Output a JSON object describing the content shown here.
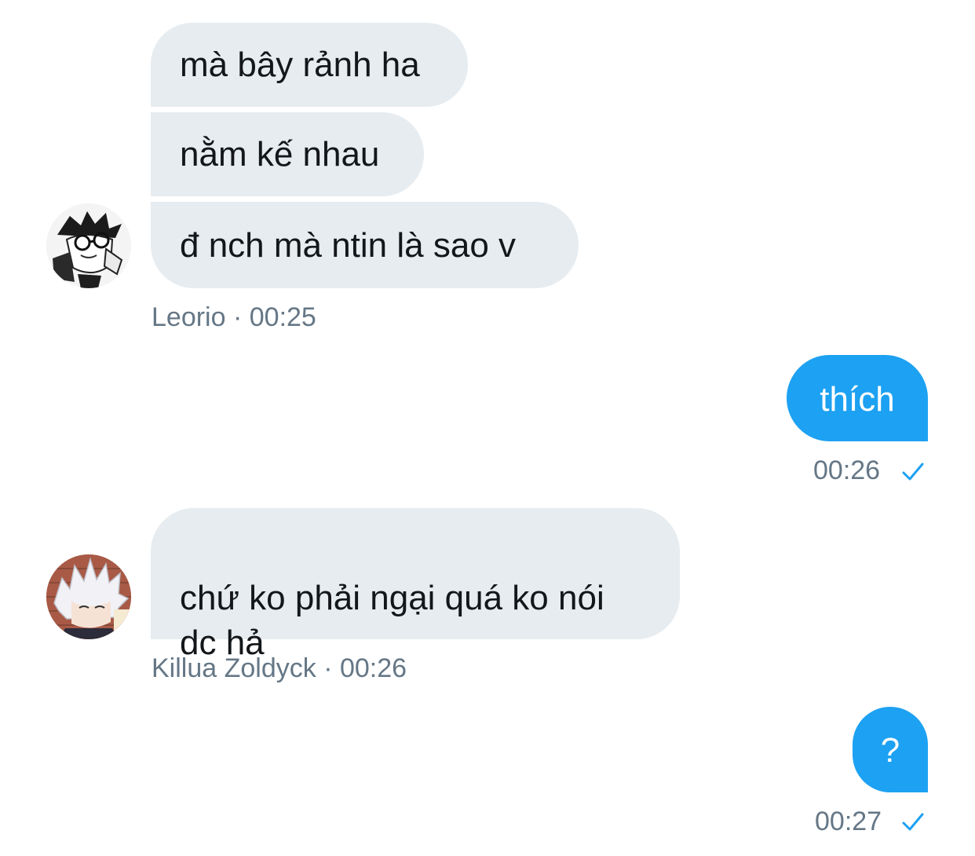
{
  "conversation": {
    "groups": [
      {
        "sender": "Leorio",
        "time": "00:25",
        "separator": "·",
        "messages": [
          "mà bây rảnh ha",
          "nằm kế nhau",
          "đ nch mà ntin là sao v"
        ]
      },
      {
        "sender": "me",
        "time": "00:26",
        "messages": [
          "thích"
        ],
        "status": "sent"
      },
      {
        "sender": "Killua Zoldyck",
        "time": "00:26",
        "separator": "·",
        "messages": [
          "chứ ko phải ngại quá ko nói\ndc hả"
        ]
      },
      {
        "sender": "me",
        "time": "00:27",
        "messages": [
          "?"
        ],
        "status": "sent"
      }
    ]
  },
  "icons": {
    "read_receipt": "checkmark-icon",
    "avatar_leorio": "avatar-leorio",
    "avatar_killua": "avatar-killua"
  },
  "colors": {
    "incoming_bubble": "#e6ecf0",
    "outgoing_bubble": "#1da1f2",
    "meta_text": "#657786",
    "check": "#1da1f2"
  }
}
